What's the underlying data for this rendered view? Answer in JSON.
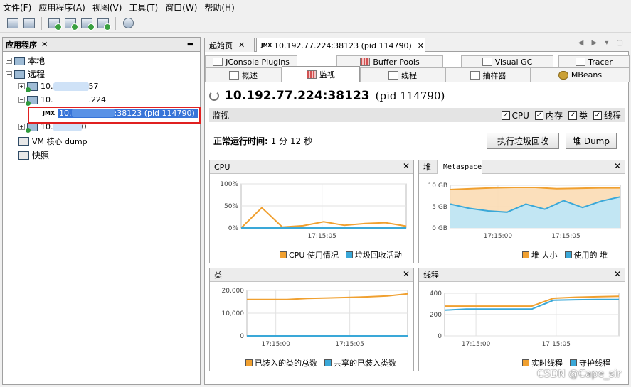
{
  "menu": [
    "文件(F)",
    "应用程序(A)",
    "视图(V)",
    "工具(T)",
    "窗口(W)",
    "帮助(H)"
  ],
  "left_panel": {
    "title": "应用程序",
    "close": "✕",
    "minimize": "▬",
    "nodes": {
      "local": "本地",
      "remote": "远程",
      "host1": "10.",
      "host1_suffix": "57",
      "host2": "10.",
      "host2_suffix": ".224",
      "jmx_node": "10.",
      "jmx_node_suffix": ":38123 (pid 114790)",
      "host3": "10.",
      "host3_suffix": "0",
      "vm_dump": "VM 核心 dump",
      "snapshot": "快照"
    }
  },
  "doc_tabs": {
    "start": "起始页",
    "jmx": "10.192.77.224:38123 (pid 114790)",
    "close": "✕",
    "nav": "◀ ▶ ▾ ▢"
  },
  "sub_tabs": {
    "row1": [
      "JConsole Plugins",
      "Buffer Pools",
      "Visual GC",
      "Tracer"
    ],
    "row2": [
      "概述",
      "监视",
      "线程",
      "抽样器",
      "MBeans"
    ]
  },
  "header": {
    "title": "10.192.77.224:38123",
    "pid": "(pid 114790)"
  },
  "monitor_bar": {
    "label": "监视",
    "checks": [
      "CPU",
      "内存",
      "类",
      "线程"
    ],
    "check_mark": "✓"
  },
  "uptime": {
    "label": "正常运行时间:",
    "value": "1 分 12 秒"
  },
  "buttons": {
    "gc": "执行垃圾回收",
    "dump": "堆 Dump"
  },
  "panels": {
    "cpu": {
      "title": "CPU",
      "legend": [
        "CPU 使用情况",
        "垃圾回收活动"
      ]
    },
    "heap": {
      "title": "堆",
      "tab2": "Metaspace",
      "legend": [
        "堆 大小",
        "使用的 堆"
      ]
    },
    "classes": {
      "title": "类",
      "legend": [
        "已装入的类的总数",
        "共享的已装入类数"
      ]
    },
    "threads": {
      "title": "线程",
      "legend": [
        "实时线程",
        "守护线程"
      ]
    },
    "close": "✕"
  },
  "colors": {
    "orange": "#f0a030",
    "blue": "#3aa8d8",
    "sel": "#3874d8",
    "red": "#e02020"
  },
  "watermark": "CSDN @Cape_sir",
  "chart_data": [
    {
      "type": "line",
      "title": "CPU",
      "x": [
        "",
        "17:15:05",
        ""
      ],
      "yticks": [
        "100%",
        "50%",
        "0%"
      ],
      "ylim": [
        0,
        100
      ],
      "series": [
        {
          "name": "CPU 使用情况",
          "color": "#f0a030",
          "points": [
            0,
            46,
            2,
            5,
            14,
            6,
            10,
            12,
            4
          ]
        },
        {
          "name": "垃圾回收活动",
          "color": "#3aa8d8",
          "points": [
            0,
            0,
            0,
            0,
            0,
            0,
            0,
            0,
            0
          ]
        }
      ]
    },
    {
      "type": "area",
      "title": "堆",
      "x": [
        "17:15:00",
        "17:15:05"
      ],
      "yticks": [
        "10 GB",
        "5 GB",
        "0 GB"
      ],
      "ylim": [
        0,
        10
      ],
      "series": [
        {
          "name": "堆 大小",
          "color": "#f0a030",
          "points": [
            9.0,
            9.2,
            9.4,
            9.5,
            9.5,
            9.2,
            9.3,
            9.4,
            9.4
          ]
        },
        {
          "name": "使用的 堆",
          "color": "#3aa8d8",
          "points": [
            5.6,
            4.6,
            4.0,
            3.7,
            5.6,
            4.4,
            6.4,
            4.8,
            6.3,
            7.3
          ]
        }
      ]
    },
    {
      "type": "line",
      "title": "类",
      "x": [
        "17:15:00",
        "17:15:05"
      ],
      "yticks": [
        "20,000",
        "10,000",
        "0"
      ],
      "ylim": [
        0,
        20000
      ],
      "series": [
        {
          "name": "已装入的类的总数",
          "color": "#f0a030",
          "points": [
            16000,
            16000,
            16000,
            16500,
            16700,
            16900,
            17200,
            17600,
            18500
          ]
        },
        {
          "name": "共享的已装入类数",
          "color": "#3aa8d8",
          "points": [
            0,
            0,
            0,
            0,
            0,
            0,
            0,
            0,
            0
          ]
        }
      ]
    },
    {
      "type": "line",
      "title": "线程",
      "x": [
        "17:15:00",
        "17:15:05"
      ],
      "yticks": [
        "400",
        "200",
        "0"
      ],
      "ylim": [
        0,
        430
      ],
      "series": [
        {
          "name": "实时线程",
          "color": "#f0a030",
          "points": [
            300,
            300,
            300,
            300,
            300,
            380,
            390,
            395,
            400
          ]
        },
        {
          "name": "守护线程",
          "color": "#3aa8d8",
          "points": [
            260,
            270,
            270,
            270,
            270,
            360,
            365,
            368,
            368
          ]
        }
      ]
    }
  ]
}
